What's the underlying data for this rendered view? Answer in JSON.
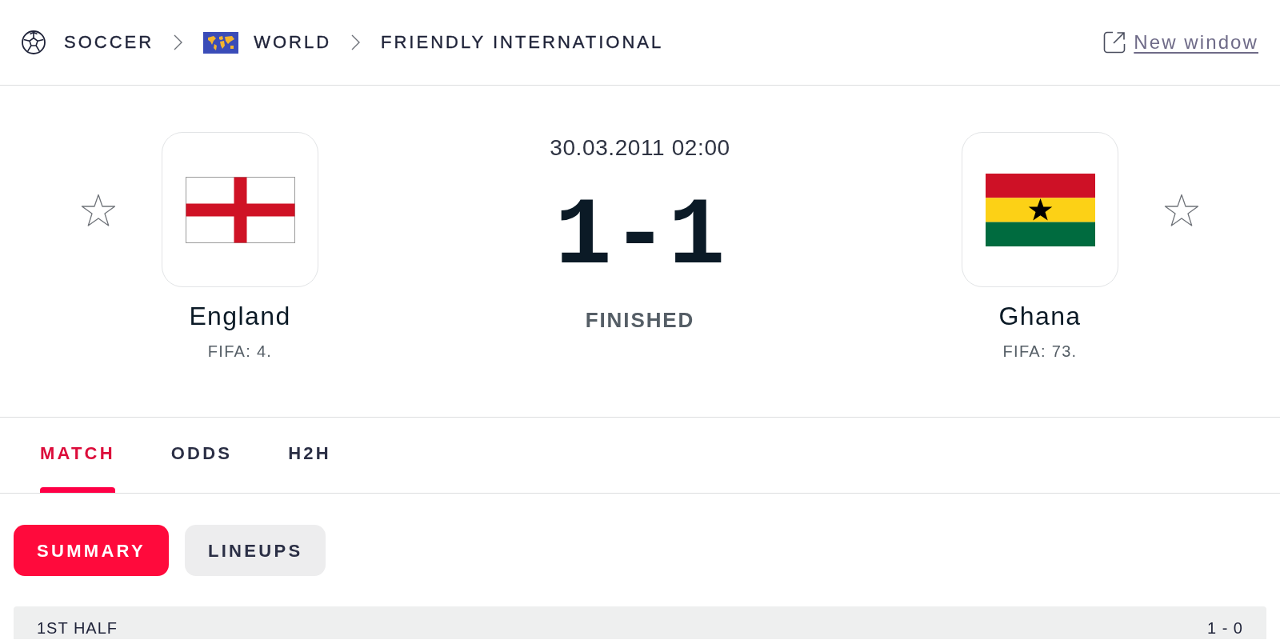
{
  "breadcrumb": [
    {
      "kind": "sport",
      "label": "SOCCER"
    },
    {
      "kind": "country",
      "label": "WORLD"
    },
    {
      "kind": "league",
      "label": "FRIENDLY INTERNATIONAL"
    }
  ],
  "new_window_link": {
    "label": "New window"
  },
  "match": {
    "date": "30.03.2011 02:00",
    "score": {
      "home": "1",
      "separator": "-",
      "away": "1"
    },
    "status": "FINISHED"
  },
  "teams": [
    {
      "kind": "england",
      "name": "England",
      "rank": "FIFA: 4.",
      "favorite": false
    },
    {
      "kind": "ghana",
      "name": "Ghana",
      "rank": "FIFA: 73.",
      "favorite": false
    }
  ],
  "tabs": [
    {
      "label": "MATCH",
      "selected": true
    },
    {
      "label": "ODDS",
      "selected": false
    },
    {
      "label": "H2H",
      "selected": false
    }
  ],
  "subtabs": [
    {
      "label": "SUMMARY",
      "selected": true
    },
    {
      "label": "LINEUPS",
      "selected": false
    }
  ],
  "sections": [
    {
      "title": "1ST HALF",
      "score": "1 - 0"
    }
  ]
}
